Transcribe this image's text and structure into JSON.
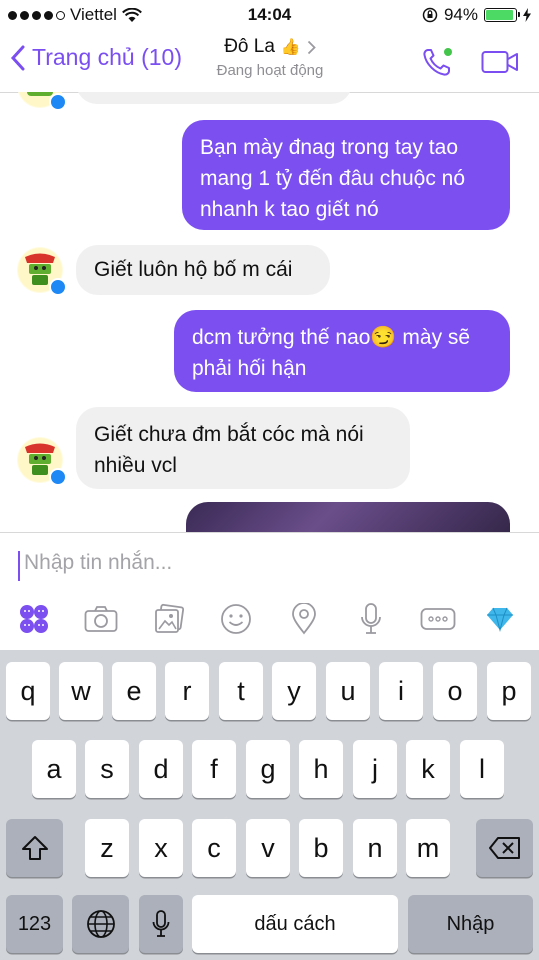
{
  "status": {
    "carrier": "Viettel",
    "time": "14:04",
    "battery": "94%",
    "battery_level": 0.94
  },
  "header": {
    "back_label": "Trang chủ (10)",
    "contact_name": "Đô La",
    "contact_emoji": "👍",
    "contact_status": "Đang hoạt động"
  },
  "messages": [
    {
      "side": "out",
      "text": "Bạn mày đnag trong tay tao mang 1 tỷ đến đâu chuộc nó nhanh k tao giết nó"
    },
    {
      "side": "in",
      "text": "Giết luôn hộ bố m cái"
    },
    {
      "side": "out",
      "text": "dcm tưởng thế nao😏 mày sẽ phải hối hận"
    },
    {
      "side": "in",
      "text": "Giết chưa đm bắt cóc mà nói nhiều vcl"
    }
  ],
  "composer": {
    "placeholder": "Nhập tin nhắn..."
  },
  "keyboard": {
    "row1": [
      "q",
      "w",
      "e",
      "r",
      "t",
      "y",
      "u",
      "i",
      "o",
      "p"
    ],
    "row2": [
      "a",
      "s",
      "d",
      "f",
      "g",
      "h",
      "j",
      "k",
      "l"
    ],
    "row3": [
      "z",
      "x",
      "c",
      "v",
      "b",
      "n",
      "m"
    ],
    "numbers": "123",
    "space": "dấu cách",
    "return": "Nhập"
  },
  "colors": {
    "accent": "#7b4ff0",
    "incoming": "#f1f0f0",
    "keyboard_bg": "#d1d4d9"
  }
}
